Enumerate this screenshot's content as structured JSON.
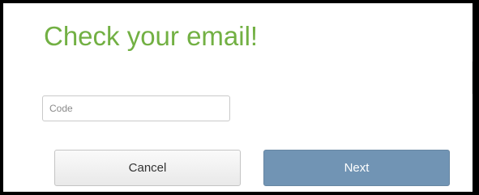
{
  "header": {
    "title": "Check your email!"
  },
  "form": {
    "code_value": "",
    "code_placeholder": "Code"
  },
  "actions": {
    "cancel_label": "Cancel",
    "next_label": "Next"
  },
  "colors": {
    "title": "#72b043",
    "next_button": "#7194b4",
    "cancel_button": "#efefef"
  }
}
